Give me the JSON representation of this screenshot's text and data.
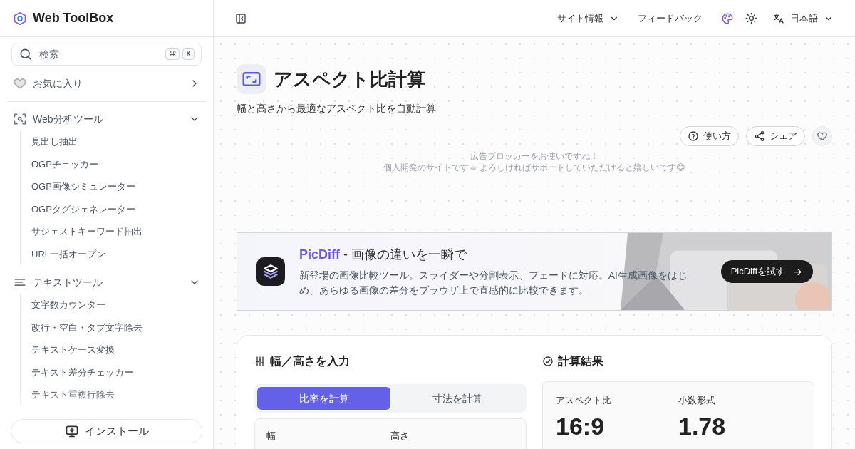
{
  "sidebar": {
    "logo": "Web ToolBox",
    "search": {
      "placeholder": "検索",
      "keys": [
        "⌘",
        "K"
      ]
    },
    "favorites": {
      "label": "お気に入り",
      "expanded": false
    },
    "groups": [
      {
        "label": "Web分析ツール",
        "kind": "scan",
        "expanded": true,
        "items": [
          "見出し抽出",
          "OGPチェッカー",
          "OGP画像シミュレーター",
          "OGPタグジェネレーター",
          "サジェストキーワード抽出",
          "URL一括オープン"
        ]
      },
      {
        "label": "テキストツール",
        "kind": "text",
        "expanded": true,
        "items": [
          "文字数カウンター",
          "改行・空白・タブ文字除去",
          "テキストケース変換",
          "テキスト差分チェッカー",
          "テキスト重複行除去"
        ]
      }
    ],
    "install": "インストール"
  },
  "header": {
    "nav": [
      {
        "label": "サイト情報",
        "kind": "dropdown"
      },
      {
        "label": "フィードバック",
        "kind": "link"
      }
    ],
    "language": "日本語"
  },
  "page": {
    "title": "アスペクト比計算",
    "subtitle": "幅と高さから最適なアスペクト比を自動計算",
    "actions": [
      {
        "label": "使い方",
        "kind": "help"
      },
      {
        "label": "シェア",
        "kind": "share"
      }
    ],
    "favorite": false,
    "notice": [
      "広告ブロッカーをお使いですね！",
      "個人開発のサイトです☕ よろしければサポートしていただけると嬉しいです😊"
    ]
  },
  "banner": {
    "app": "PicDiff",
    "headline": " - 画像の違いを一瞬で",
    "description": "新登場の画像比較ツール。スライダーや分割表示、フェードに対応。AI生成画像をはじめ、あらゆる画像の差分をブラウザ上で直感的に比較できます。",
    "button": "PicDiffを試す"
  },
  "calculator": {
    "input_title": "幅／高さを入力",
    "tabs": [
      {
        "label": "比率を計算",
        "selected": true
      },
      {
        "label": "寸法を計算",
        "selected": false
      }
    ],
    "fields": [
      "幅",
      "高さ"
    ],
    "result_title": "計算結果",
    "results": [
      {
        "label": "アスペクト比",
        "value": "16:9"
      },
      {
        "label": "小数形式",
        "value": "1.78"
      }
    ]
  }
}
